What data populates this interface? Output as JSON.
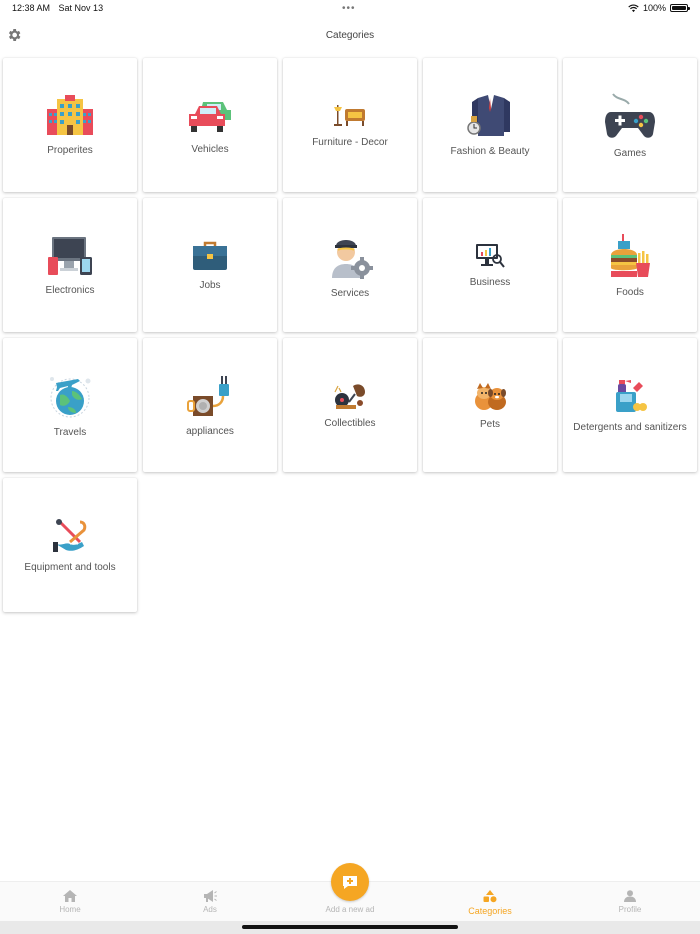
{
  "status_bar": {
    "time": "12:38 AM",
    "date": "Sat Nov 13",
    "dots": "•••",
    "battery": "100%"
  },
  "header": {
    "title": "Categories",
    "settings_icon": "gear-icon"
  },
  "categories": [
    {
      "label": "Properites",
      "icon": "building-icon"
    },
    {
      "label": "Vehicles",
      "icon": "cars-icon"
    },
    {
      "label": "Furniture - Decor",
      "icon": "furniture-icon"
    },
    {
      "label": "Fashion & Beauty",
      "icon": "suit-icon"
    },
    {
      "label": "Games",
      "icon": "gamepad-icon"
    },
    {
      "label": "Electronics",
      "icon": "devices-icon"
    },
    {
      "label": "Jobs",
      "icon": "briefcase-icon"
    },
    {
      "label": "Services",
      "icon": "worker-icon"
    },
    {
      "label": "Business",
      "icon": "chart-monitor-icon"
    },
    {
      "label": "Foods",
      "icon": "burger-icon"
    },
    {
      "label": "Travels",
      "icon": "globe-plane-icon"
    },
    {
      "label": "appliances",
      "icon": "plug-icon"
    },
    {
      "label": "Collectibles",
      "icon": "gramophone-icon"
    },
    {
      "label": "Pets",
      "icon": "pets-icon"
    },
    {
      "label": "Detergents and sanitizers",
      "icon": "cleaning-icon"
    },
    {
      "label": "Equipment and tools",
      "icon": "tools-icon"
    }
  ],
  "bottom_nav": {
    "home": "Home",
    "ads": "Ads",
    "add": "Add a new ad",
    "categories": "Categories",
    "profile": "Profile"
  },
  "colors": {
    "accent": "#f5a623",
    "inactive": "#b5b5b5"
  }
}
